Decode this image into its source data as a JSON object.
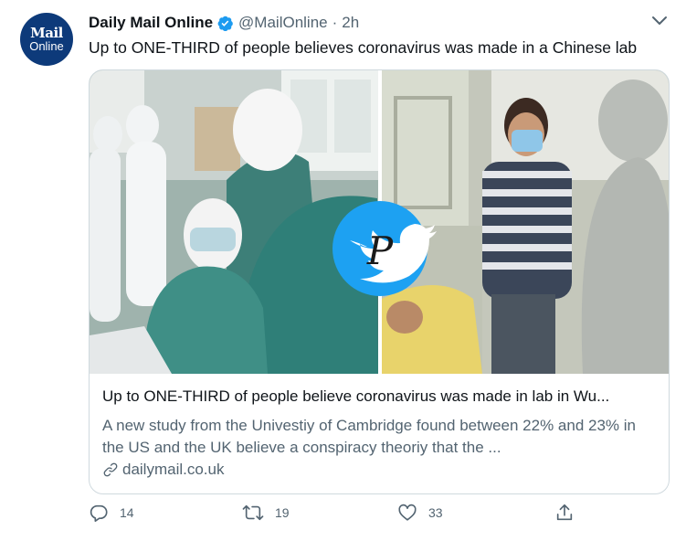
{
  "account": {
    "avatar_line1": "Mail",
    "avatar_line2": "Online",
    "name": "Daily Mail Online",
    "handle": "@MailOnline",
    "separator": "·",
    "time": "2h"
  },
  "tweet": {
    "text": "Up to ONE-THIRD of people believes coronavirus was made in a Chinese lab"
  },
  "card": {
    "title": "Up to ONE-THIRD of people believe coronavirus was made in lab in Wu...",
    "description": "A new study from the Univestiy of Cambridge found between 22% and 23% in the US and the UK believe a conspiracy theoriy that the ...",
    "domain": "dailymail.co.uk",
    "watermark_letter": "P"
  },
  "actions": {
    "replies": "14",
    "retweets": "19",
    "likes": "33"
  },
  "colors": {
    "text": "#0f1419",
    "secondary": "#536471",
    "verified": "#1d9bf0",
    "twitter_blue": "#1da1f2",
    "border": "#cfd9de",
    "avatar": "#0d3a7a"
  },
  "icons": [
    "verified-icon",
    "chevron-down-icon",
    "link-icon",
    "reply-icon",
    "retweet-icon",
    "like-icon",
    "share-icon",
    "twitter-bird-icon"
  ]
}
